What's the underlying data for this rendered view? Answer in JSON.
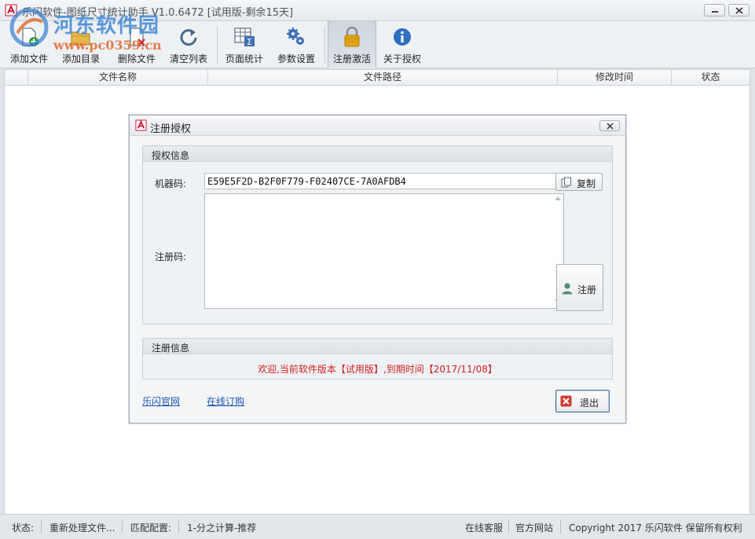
{
  "window": {
    "title": "乐闪软件-图纸尺寸统计助手 V1.0.6472 [试用版-剩余15天]"
  },
  "watermark": {
    "site_name": "河东软件园",
    "url": "www.pc0359.cn"
  },
  "toolbar": {
    "items": [
      {
        "label": "添加文件",
        "icon": "add-file-icon"
      },
      {
        "label": "添加目录",
        "icon": "add-folder-icon"
      },
      {
        "label": "删除文件",
        "icon": "delete-file-icon"
      },
      {
        "label": "清空列表",
        "icon": "refresh-icon"
      },
      {
        "label": "页面统计",
        "icon": "sum-table-icon"
      },
      {
        "label": "参数设置",
        "icon": "gears-icon"
      },
      {
        "label": "注册激活",
        "icon": "padlock-icon"
      },
      {
        "label": "关于授权",
        "icon": "info-icon"
      }
    ]
  },
  "file_list": {
    "columns": [
      "文件名称",
      "文件路径",
      "修改时间",
      "状态"
    ]
  },
  "status_bar": {
    "status_label": "状态:",
    "status_value": "重新处理文件...",
    "config_label": "匹配配置:",
    "config_value": "1-分之计算-推荐",
    "support": "在线客服",
    "website": "官方网站",
    "copyright": "Copyright 2017 乐闪软件 保留所有权利"
  },
  "dialog": {
    "title": "注册授权",
    "auth_group_title": "授权信息",
    "machine_code_label": "机器码:",
    "machine_code": "E59E5F2D-B2F0F779-F02407CE-7A0AFDB4",
    "copy_button": "复制",
    "register_code_label": "注册码:",
    "register_code": "",
    "register_button": "注册",
    "reg_info_group_title": "注册信息",
    "reg_info_text": "欢迎,当前软件版本【试用版】,到期时间【2017/11/08】",
    "link_official": "乐闪官网",
    "link_buy": "在线订购",
    "exit_button": "退出"
  },
  "colors": {
    "accent_red": "#d02020",
    "link_blue": "#1a55b0"
  }
}
